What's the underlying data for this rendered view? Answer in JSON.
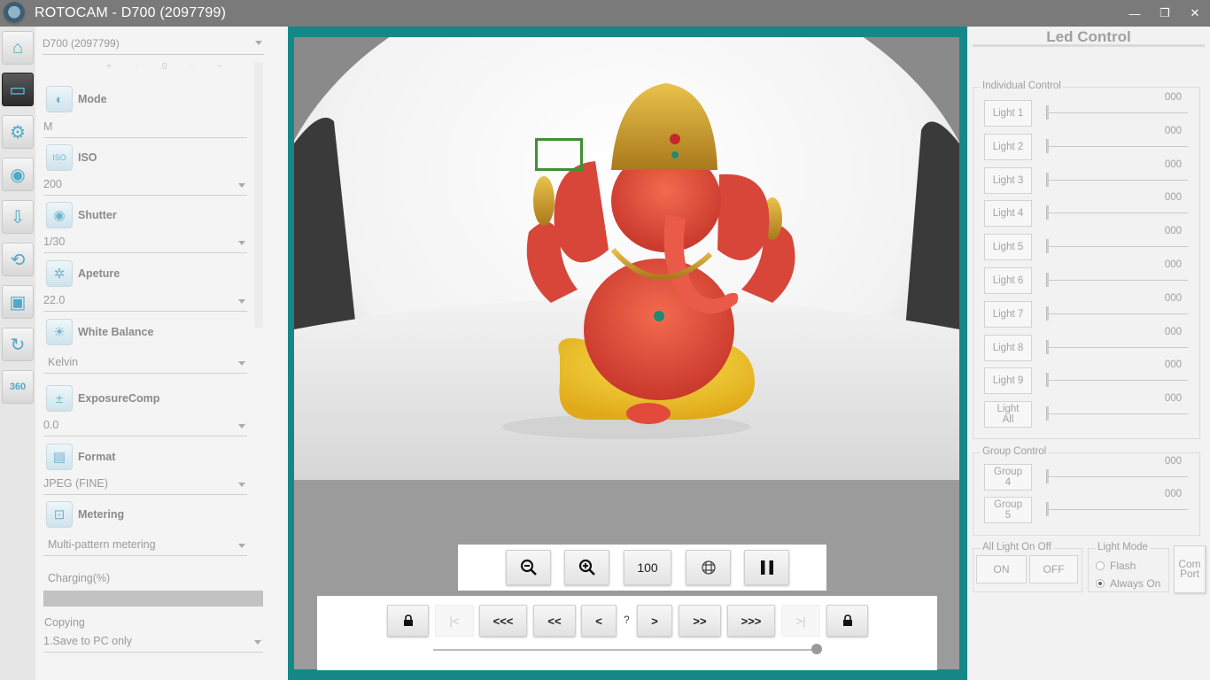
{
  "window": {
    "title": "ROTOCAM - D700 (2097799)",
    "minimize": "—",
    "restore": "❐",
    "close": "✕"
  },
  "rail": {
    "items": [
      {
        "name": "home-icon",
        "glyph": "⌂"
      },
      {
        "name": "monitor-icon",
        "glyph": "▭"
      },
      {
        "name": "camera-settings-icon",
        "glyph": "⚙"
      },
      {
        "name": "camera-icon",
        "glyph": "◉"
      },
      {
        "name": "download-icon",
        "glyph": "⇩"
      },
      {
        "name": "rotate-360-icon",
        "glyph": "⟲"
      },
      {
        "name": "cube-icon",
        "glyph": "▣"
      },
      {
        "name": "refresh-icon",
        "glyph": "↻"
      },
      {
        "name": "360-plus-icon",
        "glyph": "360"
      }
    ]
  },
  "settings": {
    "device": "D700 (2097799)",
    "dial": "+ · 0 · −",
    "mode": {
      "label": "Mode",
      "value": "M"
    },
    "iso": {
      "label": "ISO",
      "value": "200"
    },
    "shutter": {
      "label": "Shutter",
      "value": "1/30"
    },
    "aperture": {
      "label": "Apeture",
      "value": "22.0"
    },
    "white_balance": {
      "label": "White Balance",
      "value": "Kelvin"
    },
    "exposure": {
      "label": "ExposureComp",
      "value": "0.0"
    },
    "format": {
      "label": "Format",
      "value": "JPEG (FINE)"
    },
    "metering": {
      "label": "Metering",
      "value": "Multi-pattern metering"
    },
    "charging_label": "Charging(%)",
    "charging_level": 0,
    "copying_label": "Copying",
    "copying_value": "1.Save to PC only"
  },
  "viewer": {
    "zoom_value": "100",
    "nav": {
      "first": "|<",
      "back3": "<<<",
      "back2": "<<",
      "back1": "<",
      "position": "?",
      "fwd1": ">",
      "fwd2": ">>",
      "fwd3": ">>>",
      "last": ">|"
    },
    "slider_position": 1.0
  },
  "led": {
    "title": "Led Control",
    "individual_label": "Individual Control",
    "lights": [
      {
        "label": "Light 1",
        "value": "000"
      },
      {
        "label": "Light 2",
        "value": "000"
      },
      {
        "label": "Light 3",
        "value": "000"
      },
      {
        "label": "Light 4",
        "value": "000"
      },
      {
        "label": "Light 5",
        "value": "000"
      },
      {
        "label": "Light 6",
        "value": "000"
      },
      {
        "label": "Light 7",
        "value": "000"
      },
      {
        "label": "Light 8",
        "value": "000"
      },
      {
        "label": "Light 9",
        "value": "000"
      },
      {
        "label": "Light All",
        "value": "000"
      }
    ],
    "group_label": "Group Control",
    "groups": [
      {
        "label": "Group 4",
        "value": "000"
      },
      {
        "label": "Group 5",
        "value": "000"
      }
    ],
    "all_onoff_label": "All Light On Off",
    "on_label": "ON",
    "off_label": "OFF",
    "light_mode_label": "Light Mode",
    "flash_label": "Flash",
    "always_on_label": "Always On",
    "always_on_selected": true,
    "com_port_label": "Com Port"
  }
}
